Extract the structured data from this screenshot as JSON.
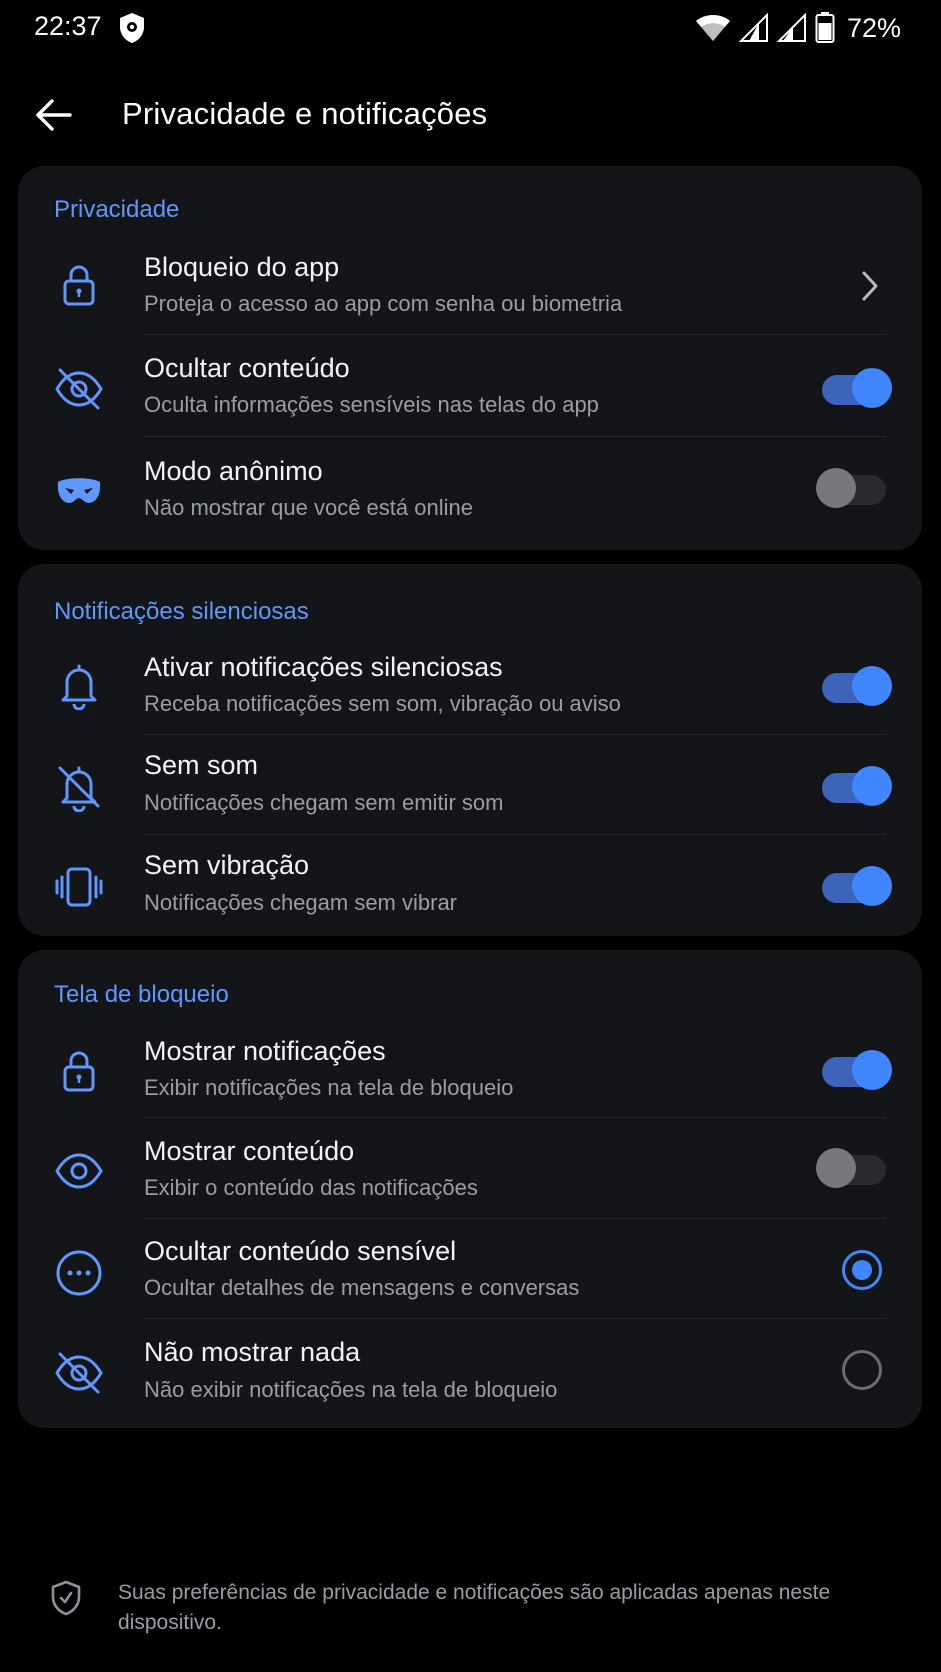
{
  "status_bar": {
    "time": "22:37",
    "battery": "72%",
    "icons": [
      "shield-icon",
      "wifi-icon",
      "signal-icon",
      "signal-icon",
      "battery-icon"
    ]
  },
  "app_bar": {
    "title": "Privacidade e notificações",
    "back_icon": "arrow-left-icon"
  },
  "sections": {
    "privacy": {
      "header": "Privacidade",
      "items": [
        {
          "title": "Bloqueio do app",
          "subtitle": "Proteja o acesso ao app com senha ou biometria",
          "icon": "lock-icon",
          "control": "chevron"
        },
        {
          "title": "Ocultar conteúdo",
          "subtitle": "Oculta informações sensíveis nas telas do app",
          "icon": "eye-off-icon",
          "control": "toggle",
          "on": true
        },
        {
          "title": "Modo anônimo",
          "subtitle": "Não mostrar que você está online",
          "icon": "mask-icon",
          "control": "toggle",
          "on": false
        }
      ]
    },
    "silent": {
      "header": "Notificações silenciosas",
      "items": [
        {
          "title": "Ativar notificações silenciosas",
          "subtitle": "Receba notificações sem som, vibração ou aviso",
          "icon": "bell-icon",
          "control": "toggle",
          "on": true
        },
        {
          "title": "Sem som",
          "subtitle": "Notificações chegam sem emitir som",
          "icon": "bell-off-icon",
          "control": "toggle",
          "on": true
        },
        {
          "title": "Sem vibração",
          "subtitle": "Notificações chegam sem vibrar",
          "icon": "vibrate-icon",
          "control": "toggle",
          "on": true
        }
      ]
    },
    "lock_screen": {
      "header": "Tela de bloqueio",
      "items": [
        {
          "title": "Mostrar notificações",
          "subtitle": "Exibir notificações na tela de bloqueio",
          "icon": "lock-icon",
          "control": "toggle",
          "on": true
        },
        {
          "title": "Mostrar conteúdo",
          "subtitle": "Exibir o conteúdo das notificações",
          "icon": "eye-icon",
          "control": "toggle",
          "on": false
        },
        {
          "title": "Ocultar conteúdo sensível",
          "subtitle": "Ocultar detalhes de mensagens e conversas",
          "icon": "more-horizontal-circle-icon",
          "control": "radio",
          "checked": true
        },
        {
          "title": "Não mostrar nada",
          "subtitle": "Não exibir notificações na tela de bloqueio",
          "icon": "eye-off-icon",
          "control": "radio",
          "checked": false
        }
      ]
    }
  },
  "footer": {
    "icon": "shield-check-icon",
    "text": "Suas preferências de privacidade e notificações são aplicadas apenas neste dispositivo."
  },
  "colors": {
    "accent": "#3f86ff",
    "header_accent": "#5e98ff",
    "card_bg": "#141518",
    "background": "#000000"
  }
}
